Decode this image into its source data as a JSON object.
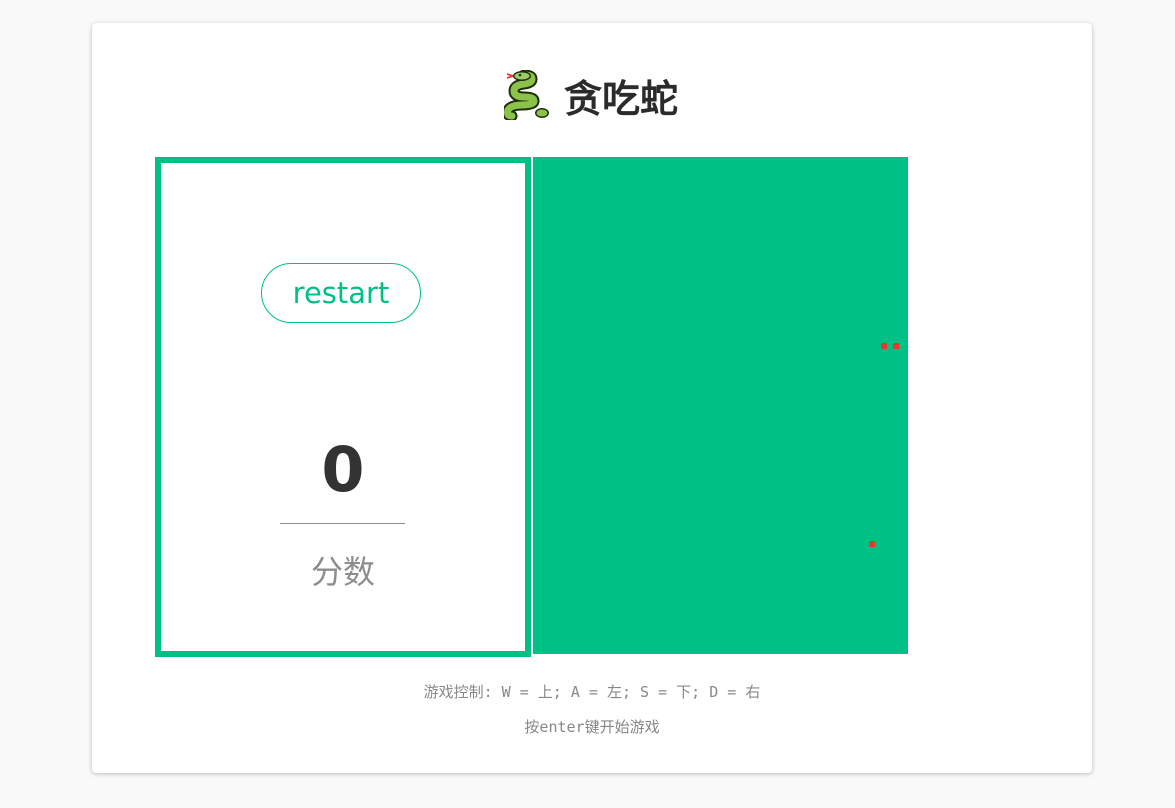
{
  "header": {
    "title": "贪吃蛇",
    "icon": "snake-icon"
  },
  "score_panel": {
    "restart_label": "restart",
    "score": "0",
    "score_label": "分数"
  },
  "board": {
    "background_color": "#00c185",
    "food_color": "#e53a2a",
    "cells": [
      {
        "col": 58,
        "row": 31
      },
      {
        "col": 60,
        "row": 31
      },
      {
        "col": 56,
        "row": 64
      }
    ]
  },
  "instructions": {
    "controls": "游戏控制: W = 上; A = 左; S = 下; D = 右",
    "start": "按enter键开始游戏"
  },
  "colors": {
    "accent": "#00c185",
    "text_dark": "#333333",
    "text_muted": "#8d8d8d"
  }
}
